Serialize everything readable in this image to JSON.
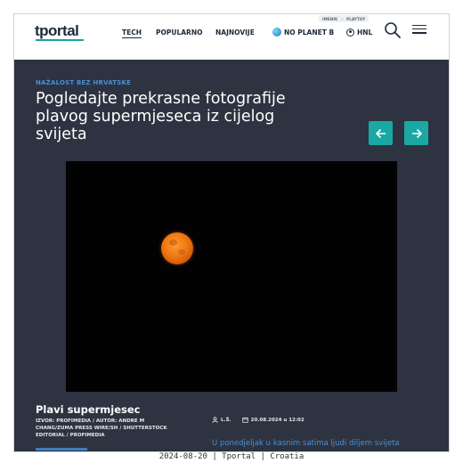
{
  "header": {
    "logo": "tportal",
    "top_links": [
      "IMENIK",
      "PLAYTOY"
    ],
    "nav": [
      {
        "label": "TECH",
        "active": true
      },
      {
        "label": "POPULARNO",
        "active": false
      },
      {
        "label": "NAJNOVIJE",
        "active": false
      },
      {
        "label": "NO PLANET B",
        "icon": "globe-icon"
      },
      {
        "label": "HNL",
        "icon": "football-icon"
      }
    ],
    "icons": [
      "search-icon",
      "hamburger-menu-icon"
    ]
  },
  "article": {
    "kicker": "NAŽALOST BEZ HRVATSKE",
    "headline": "Pogledajte prekrasne fotografije plavog supermjeseca iz cijelog svijeta",
    "gallery": {
      "prev_icon": "arrow-left-icon",
      "next_icon": "arrow-right-icon",
      "photo_caption_title": "Plavi supermjesec",
      "photo_source": "IZVOR: PROFIMEDIA / AUTOR: ANDRE M CHANG/ZUMA PRESS WIRE/SH / SHUTTERSTOCK EDITORIAL / PROFIMEDIA"
    },
    "author": "L.Š.",
    "date": "20.08.2024 u 12:02",
    "lead": "U ponedjeljak u kasnim satima ljudi diljem svijeta"
  },
  "colors": {
    "accent": "#1aa8a4",
    "link": "#4a8fd6",
    "background": "#2d3340"
  },
  "footer_caption": "2024-08-20 | Tportal | Croatia"
}
